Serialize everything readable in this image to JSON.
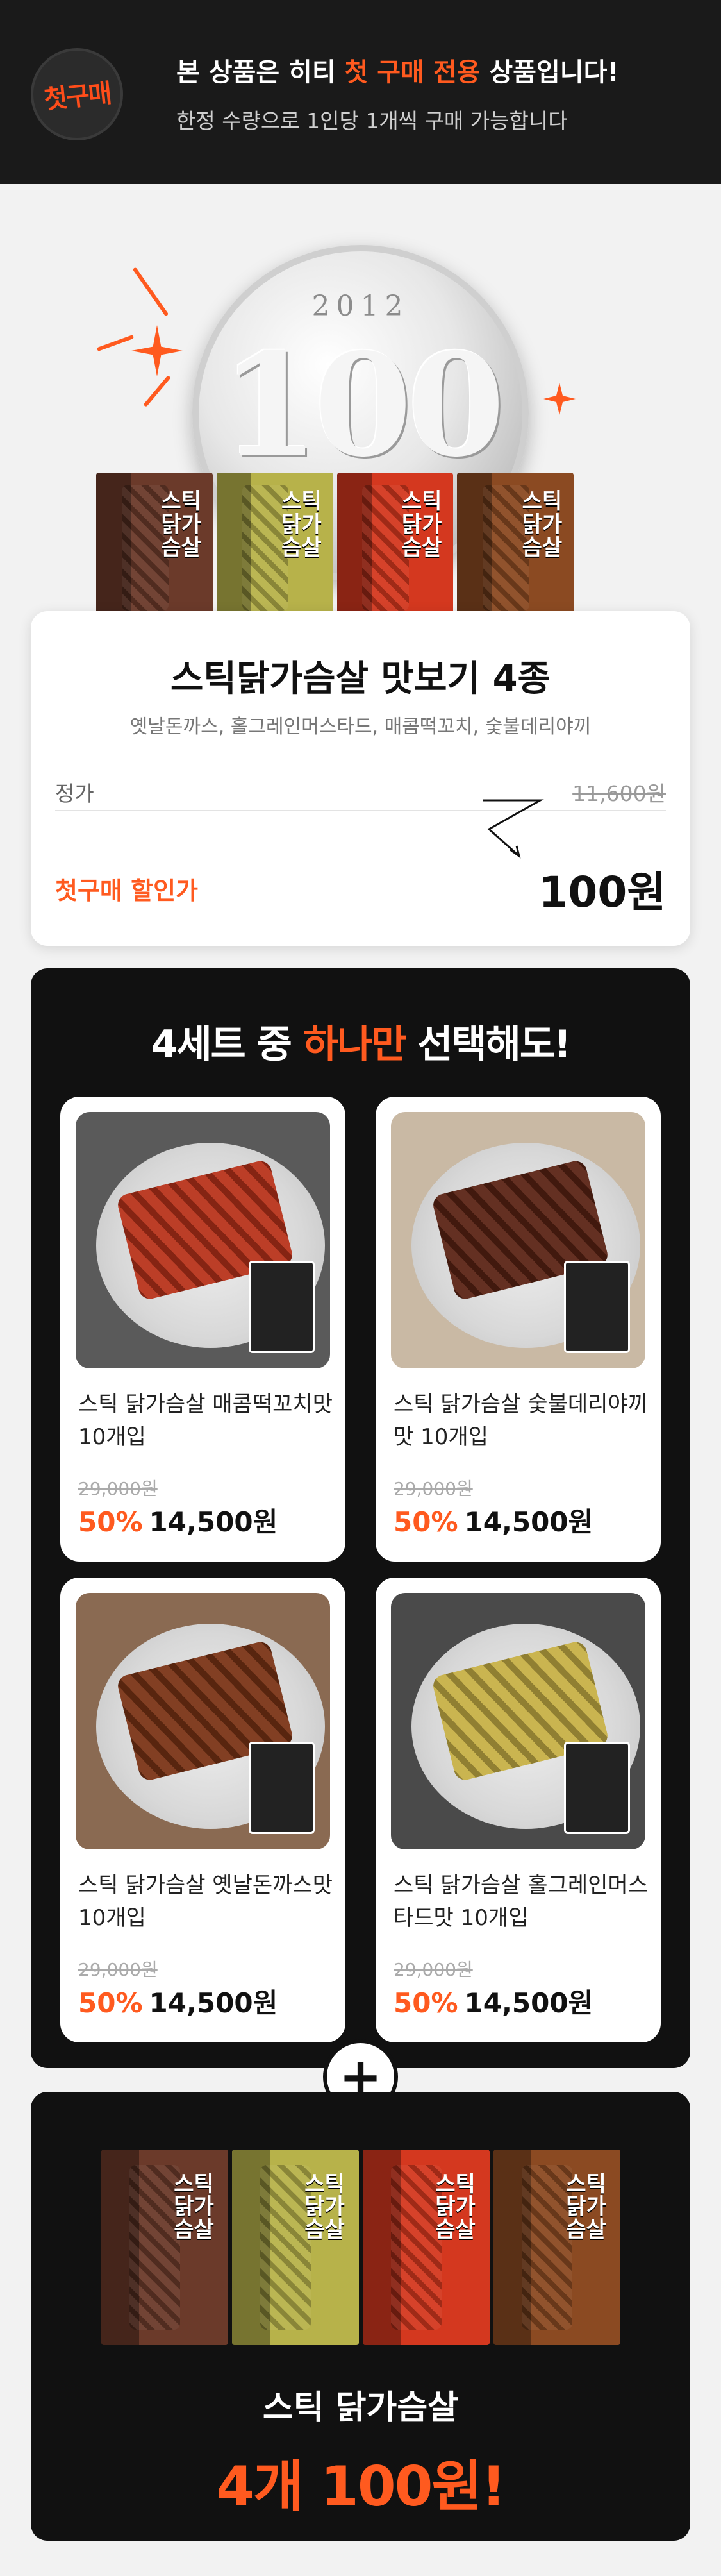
{
  "banner": {
    "badge_text": "첫구매",
    "title_pre": "본 상품은 히티 ",
    "title_highlight": "첫 구매 전용",
    "title_post": " 상품입니다!",
    "subtitle": "한정 수량으로 1인당 1개씩 구매 가능합니다",
    "accent_color": "#ff5a1f"
  },
  "hero": {
    "coin_year": "2012",
    "coin_value": "100",
    "products": [
      {
        "label": "스틱닭가슴살",
        "color": "#6b3a2a"
      },
      {
        "label": "스틱닭가슴살",
        "color": "#b7b24a"
      },
      {
        "label": "스틱닭가슴살",
        "color": "#d4381f"
      },
      {
        "label": "스틱닭가슴살",
        "color": "#8b4a22"
      }
    ]
  },
  "price_card": {
    "title": "스틱닭가슴살 맛보기 4종",
    "subtitle": "옛날돈까스, 홀그레인머스타드, 매콤떡꼬치, 숯불데리야끼",
    "regular_label": "정가",
    "regular_price": "11,600원",
    "discount_label": "첫구매 할인가",
    "discount_price": "100원"
  },
  "sets": {
    "title_pre": "4세트 중 ",
    "title_highlight": "하나만",
    "title_post": " 선택해도!",
    "cards": [
      {
        "name": "스틱 닭가슴살 매콤떡꼬치맛 10개입",
        "original": "29,000원",
        "percent": "50%",
        "price": "14,500원",
        "food_color": "#b8321a",
        "bg": "#5a5a5a"
      },
      {
        "name": "스틱 닭가슴살 숯불데리야끼맛 10개입",
        "original": "29,000원",
        "percent": "50%",
        "price": "14,500원",
        "food_color": "#5a2314",
        "bg": "#c9b9a4"
      },
      {
        "name": "스틱 닭가슴살 옛날돈까스맛 10개입",
        "original": "29,000원",
        "percent": "50%",
        "price": "14,500원",
        "food_color": "#7a3315",
        "bg": "#8a6a52"
      },
      {
        "name": "스틱 닭가슴살 홀그레인머스타드맛 10개입",
        "original": "29,000원",
        "percent": "50%",
        "price": "14,500원",
        "food_color": "#c7b045",
        "bg": "#4a4a4a"
      }
    ]
  },
  "plus_symbol": "+",
  "bundle": {
    "name": "스틱 닭가슴살",
    "price_text": "4개 100원!"
  }
}
